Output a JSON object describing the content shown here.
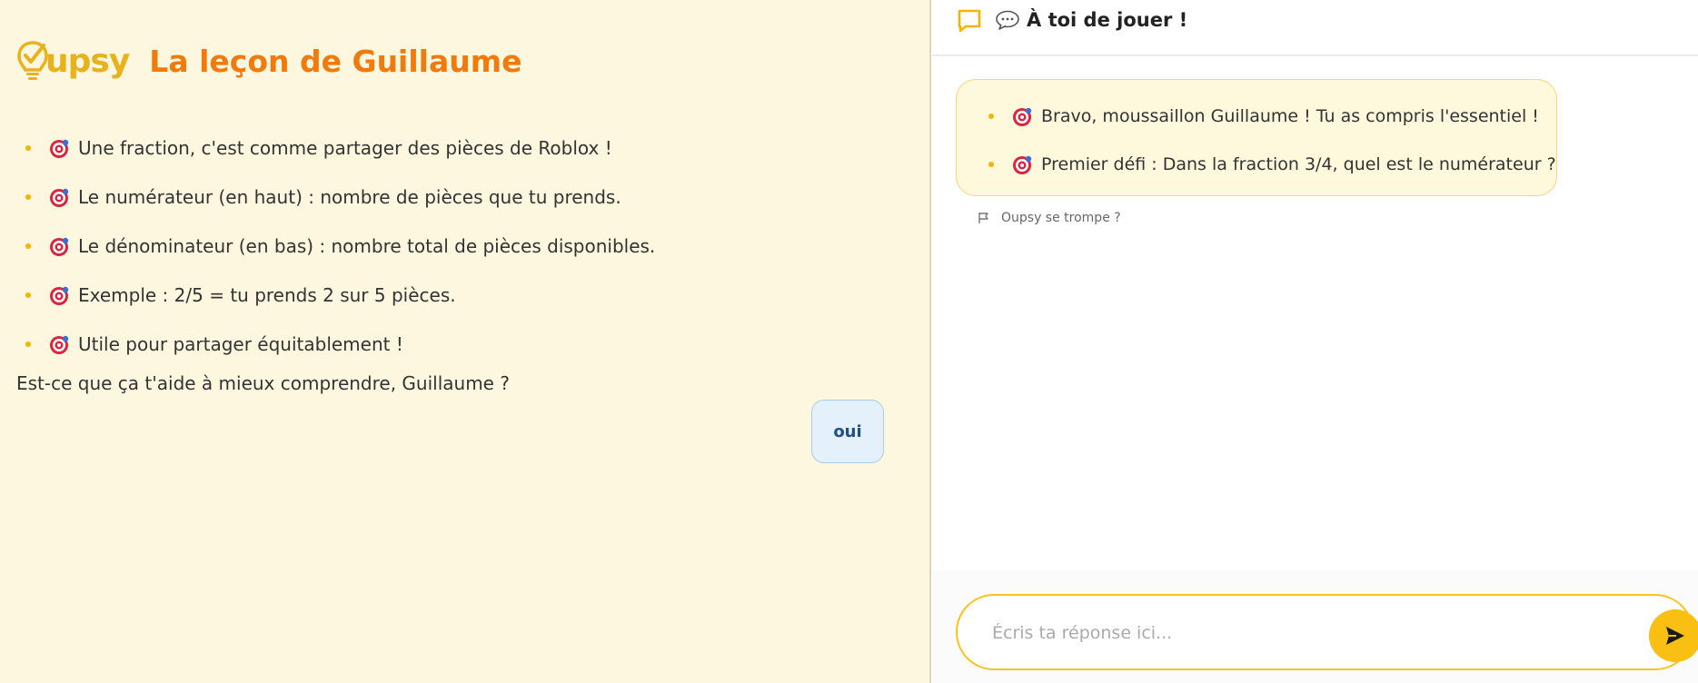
{
  "brand": {
    "logo_text": "upsy",
    "accent": "#f07a0c",
    "logo_color": "#e8b21e"
  },
  "lesson": {
    "title": "La leçon de Guillaume",
    "items": [
      {
        "icon": "target-icon",
        "text": "Une fraction, c'est comme partager des pièces de Roblox !"
      },
      {
        "icon": "target-icon",
        "text": "Le numérateur (en haut) : nombre de pièces que tu prends."
      },
      {
        "icon": "target-icon",
        "text": "Le dénominateur (en bas) : nombre total de pièces disponibles."
      },
      {
        "icon": "target-icon",
        "text": "Exemple : 2/5 = tu prends 2 sur 5 pièces."
      },
      {
        "icon": "target-icon",
        "text": "Utile pour partager équitablement !"
      }
    ],
    "question": "Est-ce que ça t'aide à mieux comprendre, Guillaume ?",
    "user_reply": "oui"
  },
  "chat": {
    "header_title": "À toi de jouer !",
    "header_icon": "speech-bubble-icon",
    "bot_message": [
      {
        "icon": "target-icon",
        "text": "Bravo, moussaillon Guillaume ! Tu as compris l'essentiel !"
      },
      {
        "icon": "target-icon",
        "text": "Premier défi : Dans la fraction 3/4, quel est le numérateur ?"
      }
    ],
    "report_label": "Oupsy se trompe ?",
    "input_placeholder": "Écris ta réponse ici...",
    "input_value": "",
    "send_icon": "send-icon"
  }
}
